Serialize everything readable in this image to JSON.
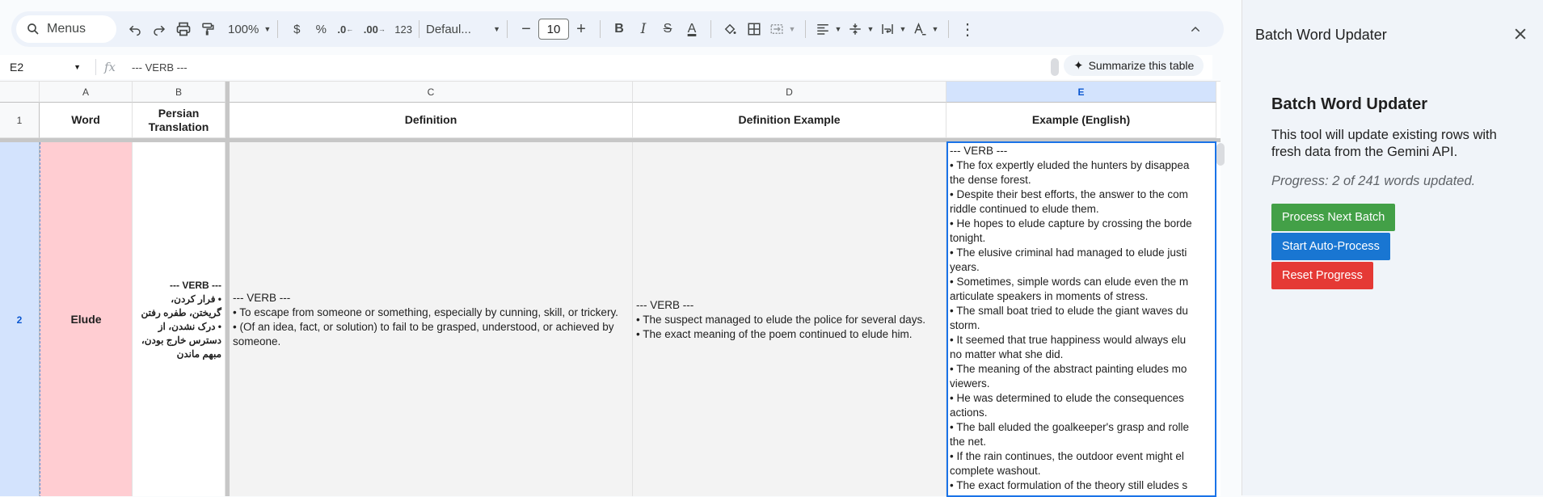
{
  "toolbar": {
    "menus_label": "Menus",
    "zoom": "100%",
    "currency": "$",
    "percent": "%",
    "dec_decrease": ".0",
    "dec_increase": ".00",
    "number_format": "123",
    "font": "Defaul...",
    "font_size": "10",
    "minus": "−",
    "plus": "+",
    "bold": "B",
    "italic": "I",
    "strike": "S",
    "text_color": "A",
    "text_color_bar": "#000000"
  },
  "formula_bar": {
    "cell_ref": "E2",
    "fx": "fx",
    "value": "--- VERB ---",
    "summarize_label": "Summarize this table"
  },
  "sheet": {
    "columns": [
      "A",
      "B",
      "C",
      "D",
      "E"
    ],
    "rows": [
      "1",
      "2"
    ],
    "headers": {
      "word": "Word",
      "persian": "Persian Translation",
      "definition": "Definition",
      "definition_example": "Definition Example",
      "example_english": "Example (English)"
    },
    "row2": {
      "word": "Elude",
      "persian": "--- VERB ---\n• فرار کردن، گریختن، طفره رفتن\n• درک نشدن، از دسترس خارج بودن، مبهم ماندن",
      "definition": "--- VERB ---\n• To escape from someone or something, especially by cunning, skill, or trickery.\n• (Of an idea, fact, or solution) to fail to be grasped, understood, or achieved by someone.",
      "definition_example": "--- VERB ---\n• The suspect managed to elude the police for several days.\n• The exact meaning of the poem continued to elude him.",
      "example_english": "--- VERB ---\n• The fox expertly eluded the hunters by disappea\nthe dense forest.\n• Despite their best efforts, the answer to the com\nriddle continued to elude them.\n• He hopes to elude capture by crossing the borde\ntonight.\n• The elusive criminal had managed to elude justi\nyears.\n• Sometimes, simple words can elude even the m\narticulate speakers in moments of stress.\n• The small boat tried to elude the giant waves du\nstorm.\n• It seemed that true happiness would always elu\nno matter what she did.\n• The meaning of the abstract painting eludes mo\nviewers.\n• He was determined to elude the consequences \nactions.\n• The ball eluded the goalkeeper's grasp and rolle\nthe net.\n• If the rain continues, the outdoor event might el\ncomplete washout.\n• The exact formulation of the theory still eludes s"
    },
    "colors": {
      "word_cell_bg": "#ffcdd2",
      "selected_header_bg": "#d3e3fd"
    }
  },
  "panel": {
    "title": "Batch Word Updater",
    "heading": "Batch Word Updater",
    "description": "This tool will update existing rows with fresh data from the Gemini API.",
    "progress": "Progress: 2 of 241 words updated.",
    "buttons": {
      "next_batch": "Process Next Batch",
      "auto": "Start Auto-Process",
      "reset": "Reset Progress"
    },
    "colors": {
      "next_batch": "#43a047",
      "auto": "#1976d2",
      "reset": "#e53935"
    }
  }
}
